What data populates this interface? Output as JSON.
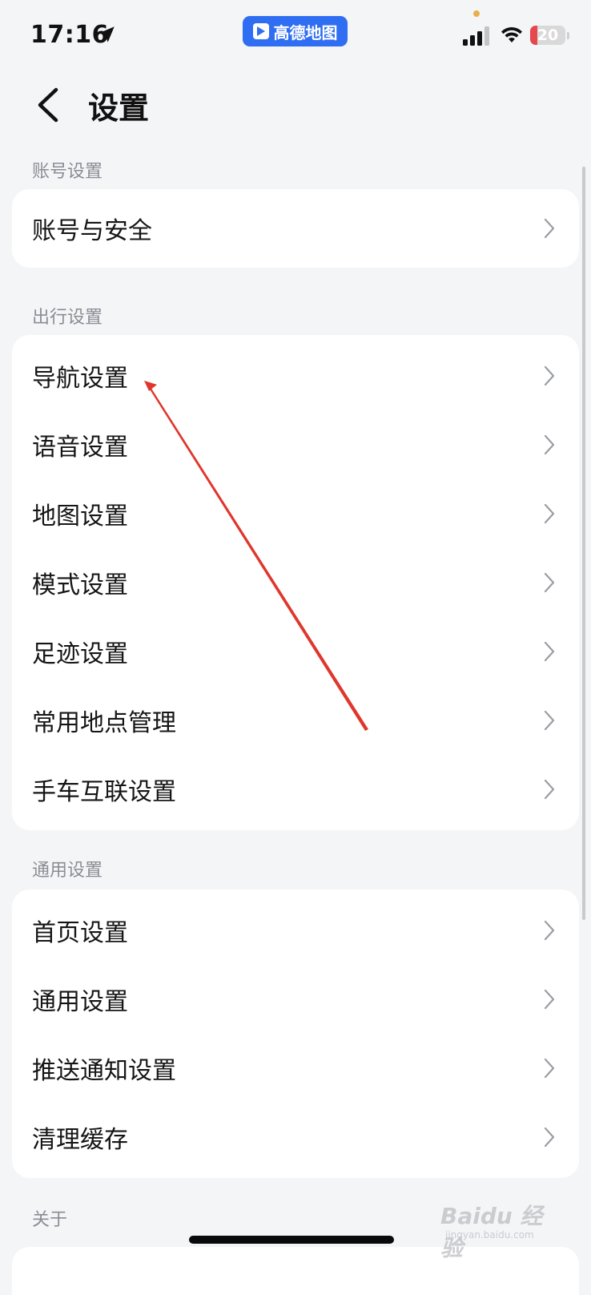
{
  "status_bar": {
    "time": "17:16",
    "app_pill": "高德地图",
    "battery": "20",
    "battery_level": 0.2,
    "battery_color": "#e5484d",
    "dot_color": "#e8b04a"
  },
  "nav": {
    "title": "设置"
  },
  "sections": {
    "account": {
      "title": "账号设置",
      "items": [
        {
          "label": "账号与安全"
        }
      ]
    },
    "travel": {
      "title": "出行设置",
      "items": [
        {
          "label": "导航设置"
        },
        {
          "label": "语音设置"
        },
        {
          "label": "地图设置"
        },
        {
          "label": "模式设置"
        },
        {
          "label": "足迹设置"
        },
        {
          "label": "常用地点管理"
        },
        {
          "label": "手车互联设置"
        }
      ]
    },
    "general": {
      "title": "通用设置",
      "items": [
        {
          "label": "首页设置"
        },
        {
          "label": "通用设置"
        },
        {
          "label": "推送通知设置"
        },
        {
          "label": "清理缓存"
        }
      ]
    },
    "about": {
      "title": "关于"
    }
  },
  "watermark": {
    "main": "Baidu 经验",
    "sub": "jingyan.baidu.com"
  },
  "colors": {
    "accent": "#2f6ef2",
    "annotation_arrow": "#e0362c",
    "background": "#f4f5f7"
  }
}
